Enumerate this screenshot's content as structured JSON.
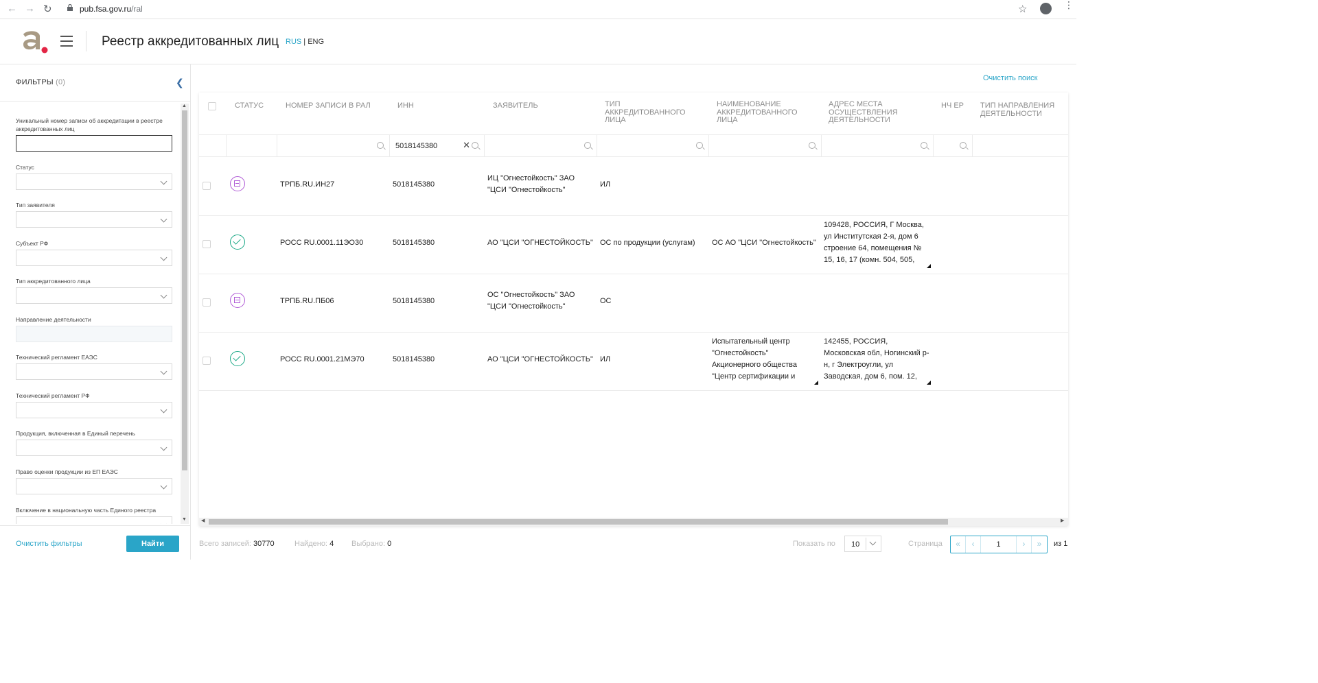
{
  "browser": {
    "url_host": "pub.fsa.gov.ru",
    "url_path": "/ral"
  },
  "header": {
    "title": "Реестр аккредитованных лиц",
    "lang_rus": "RUS",
    "lang_sep": " | ",
    "lang_eng": "ENG",
    "accent": "#2aa5c8"
  },
  "sidebar": {
    "title": "ФИЛЬТРЫ",
    "count": "(0)",
    "filters": [
      {
        "label": "Уникальный номер записи об аккредитации в реестре аккредитованных лиц",
        "kind": "text"
      },
      {
        "label": "Статус",
        "kind": "select"
      },
      {
        "label": "Тип заявителя",
        "kind": "select"
      },
      {
        "label": "Субъект РФ",
        "kind": "select"
      },
      {
        "label": "Тип аккредитованного лица",
        "kind": "select"
      },
      {
        "label": "Направление деятельности",
        "kind": "disabled"
      },
      {
        "label": "Технический регламент ЕАЭС",
        "kind": "select"
      },
      {
        "label": "Технический регламент РФ",
        "kind": "select"
      },
      {
        "label": "Продукция, включенная в Единый перечень",
        "kind": "select"
      },
      {
        "label": "Право оценки продукции из ЕП ЕАЭС",
        "kind": "select"
      },
      {
        "label": "Включение в национальную часть Единого реестра",
        "kind": "select"
      }
    ],
    "clear_filters": "Очистить фильтры",
    "find": "Найти"
  },
  "main": {
    "clear_search": "Очистить поиск",
    "columns": {
      "status": "СТАТУС",
      "record_number": "НОМЕР ЗАПИСИ В РАЛ",
      "inn": "ИНН",
      "applicant": "ЗАЯВИТЕЛЬ",
      "type": "ТИП АККРЕДИТОВАННОГО ЛИЦА",
      "name": "НАИМЕНОВАНИЕ АККРЕДИТОВАННОГО ЛИЦА",
      "address": "АДРЕС МЕСТА ОСУЩЕСТВЛЕНИЯ ДЕЯТЕЛЬНОСТИ",
      "nch_er": "НЧ ЕР",
      "direction_type": "ТИП НАПРАВЛЕНИЯ ДЕЯТЕЛЬНОСТИ"
    },
    "inn_search_value": "5018145380",
    "rows": [
      {
        "status": "archived",
        "record_number": "ТРПБ.RU.ИН27",
        "inn": "5018145380",
        "applicant": "ИЦ \"Огнестойкость\" ЗАО \"ЦСИ \"Огнестойкость\"",
        "type": "ИЛ",
        "name": "",
        "address": ""
      },
      {
        "status": "active",
        "record_number": "РОСС RU.0001.11ЭО30",
        "inn": "5018145380",
        "applicant": "АО \"ЦСИ \"ОГНЕСТОЙКОСТЬ\"",
        "type": "ОС по продукции (услугам)",
        "name": "ОС АО \"ЦСИ \"Огнестойкость\"",
        "address": "109428, РОССИЯ, Г Москва, ул Институтская 2-я, дом 6 строение 64, помещения № 15, 16, 17 (комн. 504, 505,"
      },
      {
        "status": "archived",
        "record_number": "ТРПБ.RU.ПБ06",
        "inn": "5018145380",
        "applicant": "ОС \"Огнестойкость\" ЗАО \"ЦСИ \"Огнестойкость\"",
        "type": "ОС",
        "name": "",
        "address": ""
      },
      {
        "status": "active",
        "record_number": "РОСС RU.0001.21МЭ70",
        "inn": "5018145380",
        "applicant": "АО \"ЦСИ \"ОГНЕСТОЙКОСТЬ\"",
        "type": "ИЛ",
        "name": "Испытательный центр \"Огнестойкость\" Акционерного общества \"Центр сертификации и",
        "address": "142455, РОССИЯ, Московская обл, Ногинский р-н, г Электроугли, ул Заводская, дом 6, пом. 12,"
      }
    ]
  },
  "footer": {
    "total_label": "Всего записей:",
    "total_value": "30770",
    "found_label": "Найдено:",
    "found_value": "4",
    "selected_label": "Выбрано:",
    "selected_value": "0",
    "per_page_label": "Показать по",
    "per_page_value": "10",
    "page_label": "Страница",
    "page_value": "1",
    "of_label": "из 1"
  }
}
